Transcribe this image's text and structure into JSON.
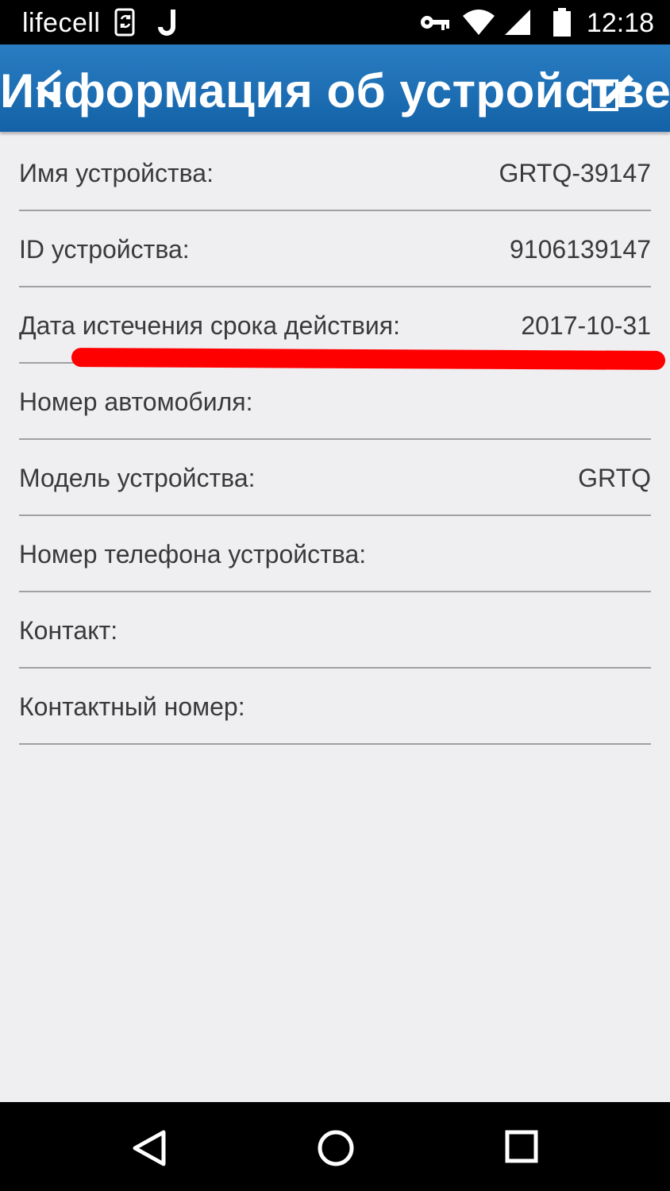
{
  "status_bar": {
    "carrier": "lifecell",
    "time": "12:18",
    "icons": [
      "sim-sync-icon",
      "j-notification-icon",
      "key-icon",
      "wifi-icon",
      "signal-icon",
      "battery-icon"
    ]
  },
  "app_bar": {
    "title": "Информация об устройстве",
    "color": "#1b6db6"
  },
  "fields": [
    {
      "label": "Имя устройства:",
      "value": "GRTQ-39147"
    },
    {
      "label": "ID устройства:",
      "value": "9106139147"
    },
    {
      "label": "Дата истечения срока действия:",
      "value": "2017-10-31"
    },
    {
      "label": "Номер автомобиля:",
      "value": ""
    },
    {
      "label": "Модель устройства:",
      "value": "GRTQ"
    },
    {
      "label": "Номер телефона устройства:",
      "value": ""
    },
    {
      "label": "Контакт:",
      "value": ""
    },
    {
      "label": "Контактный номер:",
      "value": ""
    }
  ],
  "annotation": {
    "color": "#ff0000"
  },
  "nav_bar": {
    "icons": [
      "back-triangle-icon",
      "home-circle-icon",
      "recents-square-icon"
    ]
  }
}
